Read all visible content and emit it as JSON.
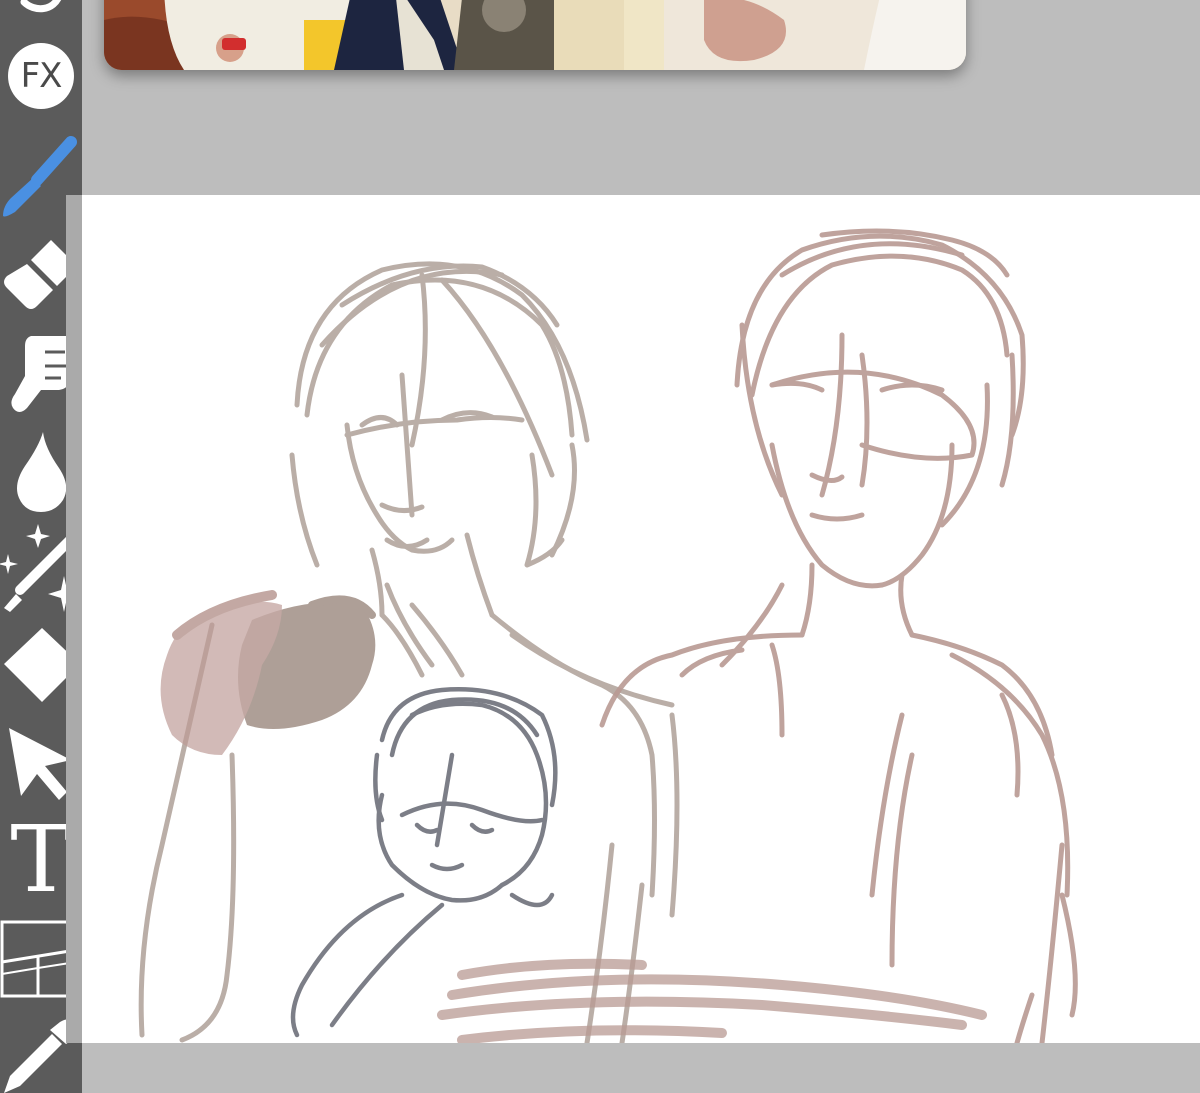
{
  "app": {
    "colors": {
      "toolbar_bg": "#5b5b5b",
      "workspace_bg": "#bdbdbd",
      "canvas_bg": "#ffffff",
      "active_tool": "#4a90e2",
      "icon": "#ffffff"
    }
  },
  "toolbar": {
    "tools": [
      {
        "name": "lasso-tool",
        "icon": "lasso-icon",
        "active": false
      },
      {
        "name": "fx-tool",
        "label": "FX",
        "icon": "fx-icon",
        "active": false
      },
      {
        "name": "brush-tool",
        "icon": "brush-icon",
        "active": true
      },
      {
        "name": "eraser-tool",
        "icon": "eraser-icon",
        "active": false
      },
      {
        "name": "smudge-tool",
        "icon": "finger-icon",
        "active": false
      },
      {
        "name": "blur-tool",
        "icon": "droplet-icon",
        "active": false
      },
      {
        "name": "magic-wand-tool",
        "icon": "magic-wand-icon",
        "active": false
      },
      {
        "name": "fill-tool",
        "icon": "diamond-icon",
        "active": false
      },
      {
        "name": "select-tool",
        "icon": "arrow-cursor-icon",
        "active": false
      },
      {
        "name": "text-tool",
        "label": "T",
        "icon": "text-icon",
        "active": false
      },
      {
        "name": "frame-tool",
        "icon": "frame-divider-icon",
        "active": false
      },
      {
        "name": "eyedropper-tool",
        "icon": "eyedropper-icon",
        "active": false
      }
    ]
  },
  "reference": {
    "visible": true
  },
  "canvas": {
    "sketch_colors": {
      "left_figure": "#b3a69e",
      "right_figure": "#b99a93",
      "child": "#6e717b",
      "hand": "#a08f86"
    }
  }
}
